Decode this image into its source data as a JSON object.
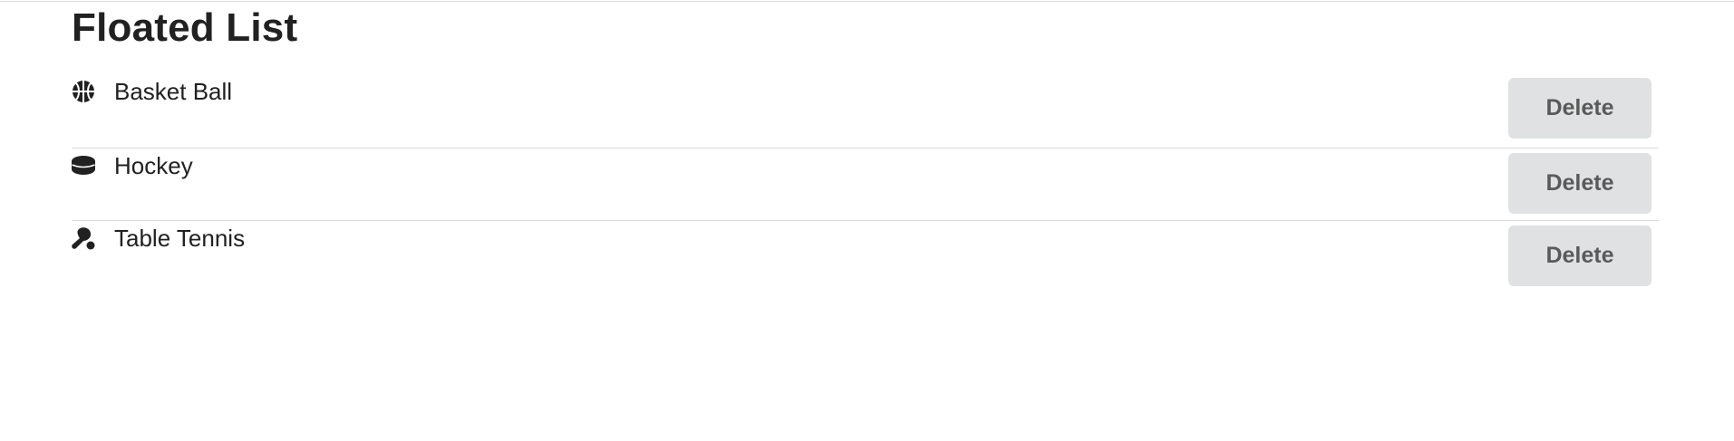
{
  "header": {
    "title": "Floated List"
  },
  "list": {
    "items": [
      {
        "label": "Basket Ball",
        "icon": "basketball-icon",
        "action_label": "Delete"
      },
      {
        "label": "Hockey",
        "icon": "hockey-puck-icon",
        "action_label": "Delete"
      },
      {
        "label": "Table Tennis",
        "icon": "table-tennis-icon",
        "action_label": "Delete"
      }
    ]
  },
  "colors": {
    "text": "#212121",
    "button_bg": "#e0e1e2",
    "button_text": "#5a5a5a",
    "divider": "#d9d9d9"
  }
}
